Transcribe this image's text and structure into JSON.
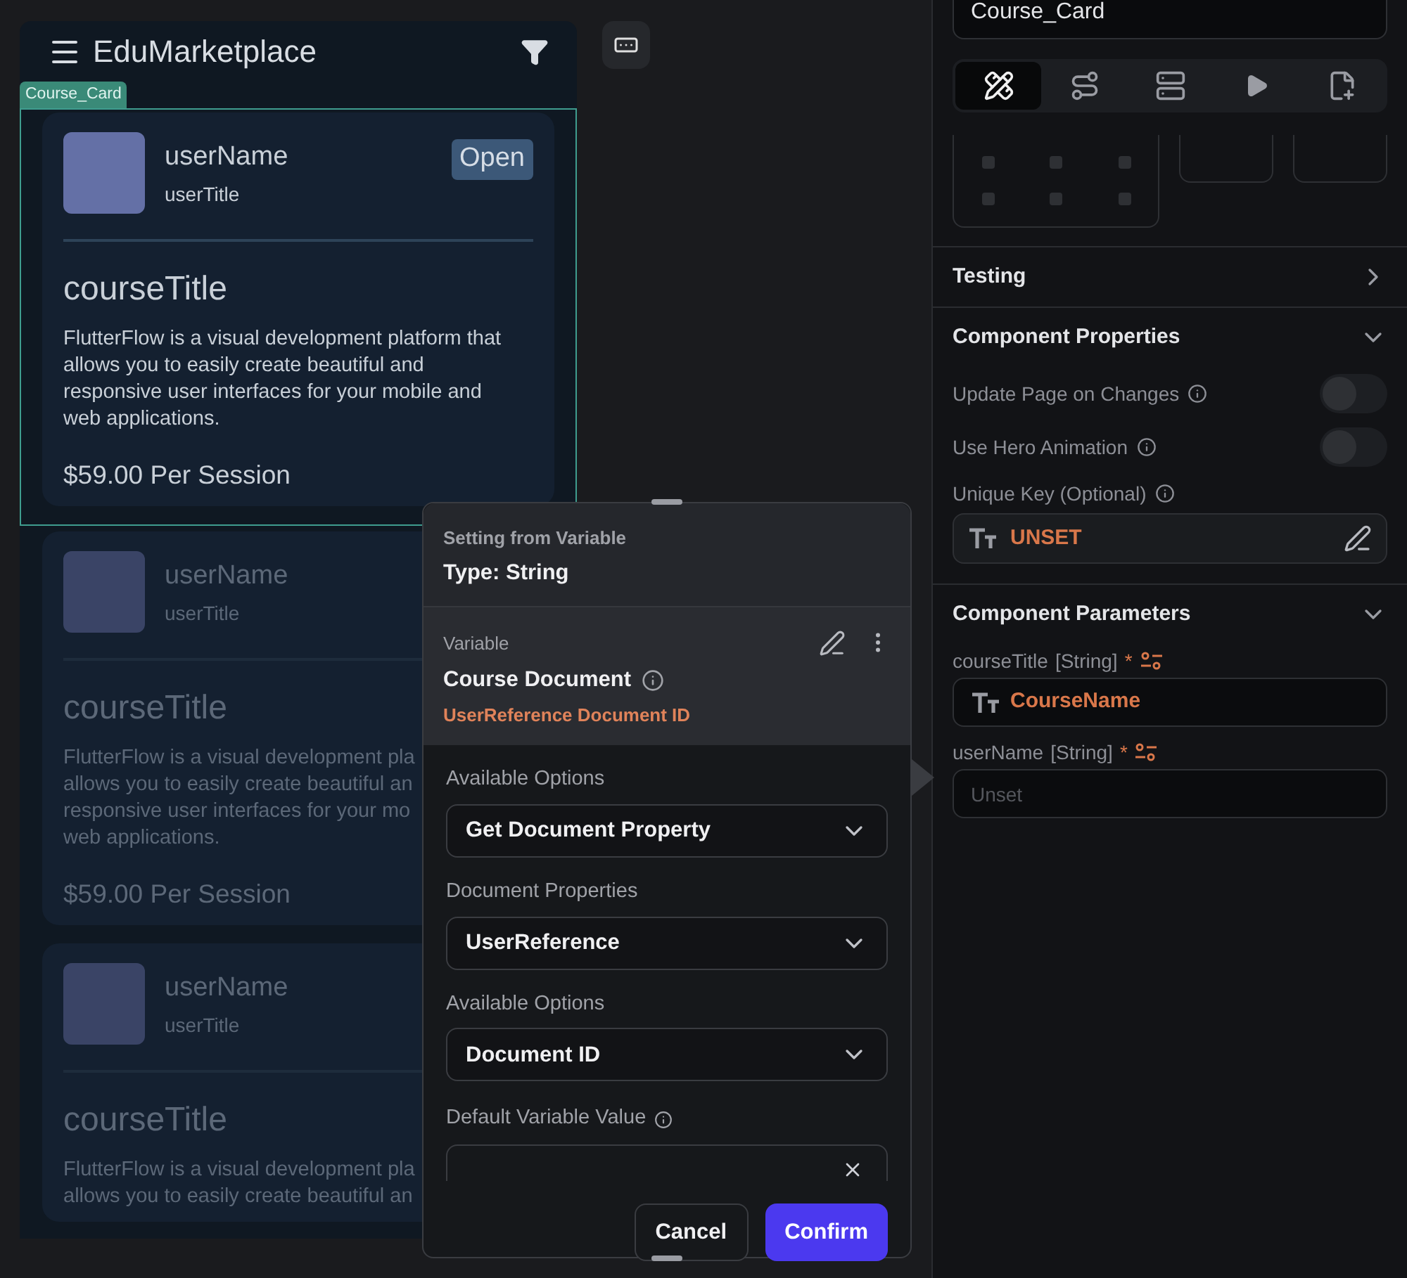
{
  "canvas": {
    "app_bar": {
      "title": "EduMarketplace"
    },
    "component_tag": "Course_Card",
    "cards": [
      {
        "selected": true,
        "user_name": "userName",
        "user_title": "userTitle",
        "badge": "Open",
        "course_title": "courseTitle",
        "description_lines": [
          "FlutterFlow is a visual development platform that",
          "allows you to easily create beautiful and",
          "responsive user interfaces for your mobile and",
          "web applications."
        ],
        "price": "$59.00 Per Session"
      },
      {
        "selected": false,
        "user_name": "userName",
        "user_title": "userTitle",
        "course_title": "courseTitle",
        "description_lines": [
          "FlutterFlow is a visual development pla",
          "allows you to easily create beautiful an",
          "responsive user interfaces for your mo",
          "web applications."
        ],
        "price": "$59.00 Per Session"
      },
      {
        "selected": false,
        "user_name": "userName",
        "user_title": "userTitle",
        "course_title": "courseTitle",
        "description_lines": [
          "FlutterFlow is a visual development pla",
          "allows you to easily create beautiful an"
        ]
      }
    ]
  },
  "properties_panel": {
    "name_field": {
      "value": "Course_Card"
    },
    "tabs": [
      {
        "kind": "design",
        "selected": true
      },
      {
        "kind": "actions",
        "selected": false
      },
      {
        "kind": "backend",
        "selected": false
      },
      {
        "kind": "preview",
        "selected": false
      },
      {
        "kind": "notes",
        "selected": false
      }
    ],
    "testing": {
      "title": "Testing",
      "expanded": false
    },
    "component_properties": {
      "title": "Component Properties",
      "expanded": true,
      "toggles": [
        {
          "label": "Update Page on Changes",
          "on": false
        },
        {
          "label": "Use Hero Animation",
          "on": false
        }
      ],
      "unique_key": {
        "label": "Unique Key (Optional)",
        "value": "UNSET"
      }
    },
    "component_parameters": {
      "title": "Component Parameters",
      "expanded": true,
      "params": [
        {
          "name": "courseTitle",
          "type": "[String]",
          "required_mark": "*",
          "value": "CourseName"
        },
        {
          "name": "userName",
          "type": "[String]",
          "required_mark": "*",
          "placeholder": "Unset"
        }
      ]
    }
  },
  "variable_popup": {
    "heading": "Setting from Variable",
    "type_label": "Type: String",
    "variable": {
      "label": "Variable",
      "name": "Course Document",
      "path": "UserReference Document ID"
    },
    "fields": [
      {
        "label": "Available Options",
        "value": "Get Document Property"
      },
      {
        "label": "Document Properties",
        "value": "UserReference"
      },
      {
        "label": "Available Options",
        "value": "Document ID"
      }
    ],
    "default_value": {
      "label": "Default Variable Value"
    },
    "buttons": [
      {
        "kind": "secondary",
        "label": "Cancel"
      },
      {
        "kind": "primary",
        "label": "Confirm"
      }
    ]
  }
}
